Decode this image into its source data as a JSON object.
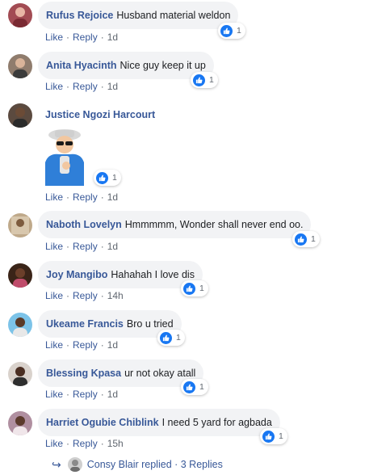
{
  "actions": {
    "like": "Like",
    "reply": "Reply",
    "dot": "·"
  },
  "comments": [
    {
      "author": "Rufus Rejoice",
      "text": "Husband material weldon",
      "reactions": "1",
      "time": "1d"
    },
    {
      "author": "Anita Hyacinth",
      "text": "Nice guy keep it up",
      "reactions": "1",
      "time": "1d"
    },
    {
      "author": "Justice Ngozi Harcourt",
      "text": "",
      "reactions": "1",
      "time": "1d",
      "sticker": "sunglasses-thumbs-up-sticker"
    },
    {
      "author": "Naboth Lovelyn",
      "text": "Hmmmmm, Wonder shall never end oo.",
      "reactions": "1",
      "time": "1d"
    },
    {
      "author": "Joy Mangibo",
      "text": "Hahahah I love dis",
      "reactions": "1",
      "time": "14h"
    },
    {
      "author": "Ukeame Francis",
      "text": "Bro u tried",
      "reactions": "1",
      "time": "1d"
    },
    {
      "author": "Blessing Kpasa",
      "text": "ur not okay atall",
      "reactions": "1",
      "time": "1d"
    },
    {
      "author": "Harriet Ogubie Chiblink",
      "text": "I need 5 yard for agbada",
      "reactions": "1",
      "time": "15h"
    }
  ],
  "replies": {
    "text": "Consy Blair replied · 3 Replies"
  },
  "colors": {
    "link": "#385898",
    "bubble": "#f2f3f5",
    "like_blue": "#1877f2",
    "meta": "#606770"
  }
}
